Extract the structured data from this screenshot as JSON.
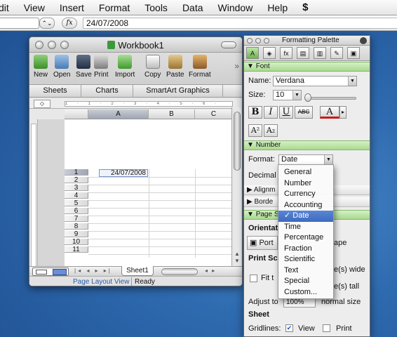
{
  "menubar": [
    "dit",
    "View",
    "Insert",
    "Format",
    "Tools",
    "Data",
    "Window",
    "Help"
  ],
  "formula_bar": {
    "stepper": "⌃⌄",
    "fx_label": "fx",
    "value": "24/07/2008"
  },
  "workbook": {
    "title": "Workbook1",
    "toolbar": [
      "New",
      "Open",
      "Save",
      "Print",
      "Import",
      "Copy",
      "Paste",
      "Format"
    ],
    "toolbar_more": "»",
    "ribbon_tabs": [
      "Sheets",
      "Charts",
      "SmartArt Graphics"
    ],
    "ruler_ticks": "1 · 1 · 2 · 3 · 4 · 5 · 6 · 7",
    "columns": [
      "A",
      "B",
      "C"
    ],
    "rows": [
      "1",
      "2",
      "3",
      "4",
      "5",
      "6",
      "7",
      "8",
      "9",
      "10",
      "11"
    ],
    "cell_A1": "24/07/2008",
    "sheet_tab": "Sheet1",
    "status_mode": "Page Layout View",
    "status_ready": "Ready"
  },
  "palette": {
    "title": "Formatting Palette",
    "font_section": "Font",
    "name_label": "Name:",
    "name_value": "Verdana",
    "size_label": "Size:",
    "size_value": "10",
    "bold": "B",
    "italic": "I",
    "underline": "U",
    "strike": "ABC",
    "color": "A",
    "superscript": "A²",
    "subscript": "A₂",
    "number_section": "Number",
    "format_label": "Format:",
    "format_value": "Date",
    "decimal_label": "Decimal",
    "alignment_label": "Alignm",
    "borders_label": "Borde",
    "page_section": "Page S",
    "orientation_label": "Orientat",
    "portrait_label": "Port",
    "landscape_label": "ape",
    "print_scaling_label": "Print Sc",
    "fit_label": "Fit t",
    "wide_label": "e(s) wide",
    "tall_label": "e(s) tall",
    "adjust_label": "Adjust to",
    "adjust_value": "100%",
    "normal_size_label": "normal size",
    "sheet_label": "Sheet",
    "gridlines_label": "Gridlines:",
    "view_label": "View",
    "print_label": "Print",
    "view_checked": true,
    "print_checked": false
  },
  "format_menu": {
    "items": [
      "General",
      "Number",
      "Currency",
      "Accounting",
      "Date",
      "Time",
      "Percentage",
      "Fraction",
      "Scientific",
      "Text",
      "Special",
      "Custom..."
    ],
    "selected": "Date",
    "selected_label": "✓ Date"
  },
  "colors": {
    "palette_section": "#a8d98e",
    "menu_highlight": "#3d6ac0",
    "font_color_underline": "#d01818",
    "desktop": "#2f6bb0"
  }
}
